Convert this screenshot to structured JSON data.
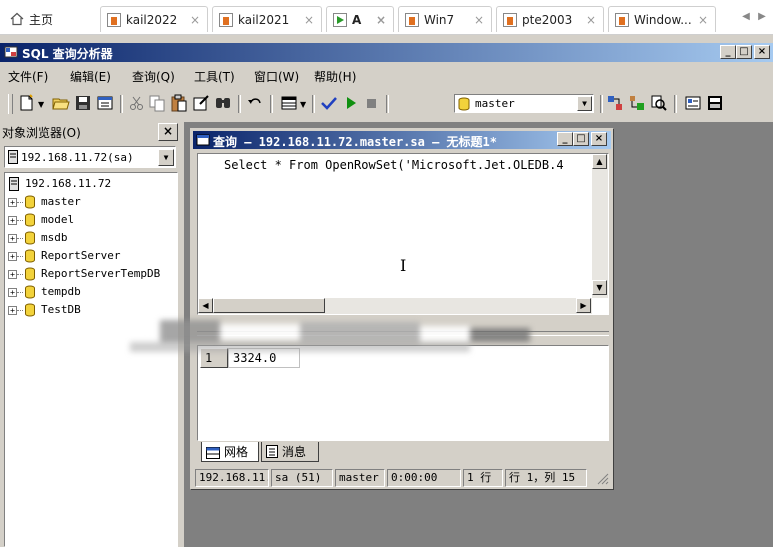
{
  "browser_tabs": [
    {
      "label": "主页",
      "icon": "home-icon",
      "active": false
    },
    {
      "label": "kail2022",
      "icon": "vm-icon",
      "active": false
    },
    {
      "label": "kail2021",
      "icon": "vm-icon",
      "active": false
    },
    {
      "label": "A",
      "icon": "vm-running-icon",
      "active": true
    },
    {
      "label": "Win7",
      "icon": "vm-icon",
      "active": false
    },
    {
      "label": "pte2003",
      "icon": "vm-icon",
      "active": false
    },
    {
      "label": "Window...",
      "icon": "vm-icon",
      "active": false
    }
  ],
  "tab_close_glyph": "×",
  "app": {
    "title": "SQL 查询分析器",
    "min_glyph": "_",
    "max_glyph": "□",
    "close_glyph": "×"
  },
  "menu": [
    "文件(F)",
    "编辑(E)",
    "查询(Q)",
    "工具(T)",
    "窗口(W)",
    "帮助(H)"
  ],
  "toolbar": {
    "database_selected": "master"
  },
  "object_browser": {
    "title": "对象浏览器(O)",
    "close_glyph": "×",
    "server_combo": "192.168.11.72(sa)",
    "server_node": "192.168.11.72",
    "databases": [
      "master",
      "model",
      "msdb",
      "ReportServer",
      "ReportServerTempDB",
      "tempdb",
      "TestDB"
    ]
  },
  "query_window": {
    "title": "查询 — 192.168.11.72.master.sa — 无标题1*",
    "sql": "Select * From OpenRowSet('Microsoft.Jet.OLEDB.4",
    "result_row_number": "1",
    "result_value": "3324.0",
    "tabs": [
      {
        "label": "网格",
        "icon": "grid-icon"
      },
      {
        "label": "消息",
        "icon": "messages-icon"
      }
    ],
    "status": {
      "server": "192.168.11.",
      "user": "sa (51)",
      "db": "master",
      "time": "0:00:00",
      "rows": "1 行",
      "position": "行 1，列 15"
    }
  },
  "colors": {
    "titlebar_start": "#0a246a",
    "titlebar_end": "#a6caf0",
    "face": "#d4d0c8",
    "workspace": "#808080",
    "db_icon": "#f2d23b"
  }
}
